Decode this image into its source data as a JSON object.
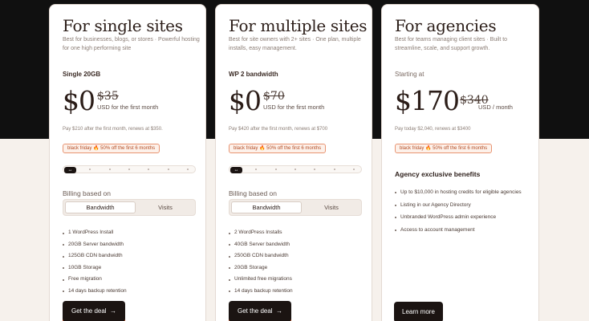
{
  "cards": [
    {
      "title": "For single sites",
      "description": "Best for businesses, blogs, or stores · Powerful hosting for one high performing site",
      "plan": "Single 20GB",
      "price": "$0",
      "old_price": "$35",
      "period": "USD for the first month",
      "renewal": "Pay $210 after the first month, renews at $350.",
      "promo": "black friday 🔥 50% off the first 6 months",
      "billing_label": "Billing based on",
      "billing_options": [
        "Bandwidth",
        "Visits"
      ],
      "features": [
        "1 WordPress Install",
        "20GB Server bandwidth",
        "125GB CDN bandwidth",
        "10GB Storage",
        "Free migration",
        "14 days backup retention"
      ],
      "cta": "Get the deal",
      "cta_arrow": "→"
    },
    {
      "title": "For multiple sites",
      "description": "Best for site owners with 2+ sites · One plan, multiple installs, easy management.",
      "plan": "WP 2 bandwidth",
      "price": "$0",
      "old_price": "$70",
      "period": "USD for the first month",
      "renewal": "Pay $420 after the first month, renews at $700",
      "promo": "black friday 🔥 50% off the first 6 months",
      "billing_label": "Billing based on",
      "billing_options": [
        "Bandwidth",
        "Visits"
      ],
      "features": [
        "2 WordPress Installs",
        "40GB Server bandwidth",
        "250GB CDN bandwidth",
        "20GB Storage",
        "Unlimited free migrations",
        "14 days backup retention"
      ],
      "cta": "Get the deal",
      "cta_arrow": "→"
    },
    {
      "title": "For agencies",
      "description": "Best for teams managing client sites · Built to streamline, scale, and support growth.",
      "plan": "Starting at",
      "price": "$170",
      "old_price": "$340",
      "period": "USD / month",
      "renewal": "Pay today $2,040, renews at $3400",
      "promo": "black friday 🔥 50% off the first 6 months",
      "section_heading": "Agency exclusive benefits",
      "features": [
        "Up to $10,000 in hosting credits for eligible agencies",
        "Listing in our Agency Directory",
        "Unbranded WordPress admin experience",
        "Access to account management"
      ],
      "cta": "Learn more"
    }
  ],
  "slider_icon": "code-arrows-icon",
  "colors": {
    "dark": "#101010",
    "accent": "#e85f2a",
    "card": "#ffffff",
    "page": "#f6f1ec"
  }
}
